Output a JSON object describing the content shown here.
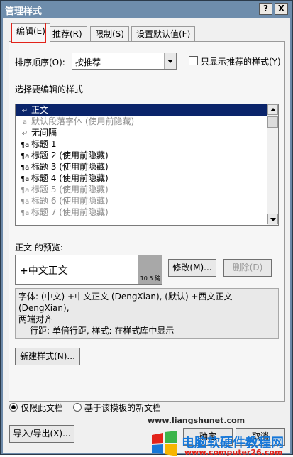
{
  "window": {
    "title": "管理样式",
    "help_btn": "?",
    "close_btn": "X"
  },
  "tabs": [
    {
      "label": "编辑(E)"
    },
    {
      "label": "推荐(R)"
    },
    {
      "label": "限制(S)"
    },
    {
      "label": "设置默认值(F)"
    }
  ],
  "sort": {
    "label": "排序顺序(O):",
    "value": "按推荐",
    "only_recommended_label": "只显示推荐的样式(Y)"
  },
  "select_label": "选择要编辑的样式",
  "styles": [
    {
      "icon": "↵",
      "name": "正文",
      "selected": true,
      "gray": false
    },
    {
      "icon": "a",
      "name": "默认段落字体  (使用前隐藏)",
      "selected": false,
      "gray": true
    },
    {
      "icon": "↵",
      "name": "无间隔",
      "selected": false,
      "gray": false
    },
    {
      "icon": "¶a",
      "name": "标题 1",
      "selected": false,
      "gray": false
    },
    {
      "icon": "¶a",
      "name": "标题 2  (使用前隐藏)",
      "selected": false,
      "gray": false
    },
    {
      "icon": "¶a",
      "name": "标题 3  (使用前隐藏)",
      "selected": false,
      "gray": false
    },
    {
      "icon": "¶a",
      "name": "标题 4  (使用前隐藏)",
      "selected": false,
      "gray": false
    },
    {
      "icon": "¶a",
      "name": "标题 5  (使用前隐藏)",
      "selected": false,
      "gray": true
    },
    {
      "icon": "¶a",
      "name": "标题 6  (使用前隐藏)",
      "selected": false,
      "gray": true
    },
    {
      "icon": "¶a",
      "name": "标题 7  (使用前隐藏)",
      "selected": false,
      "gray": true
    }
  ],
  "preview": {
    "label": "正文 的预览:",
    "text": "+中文正文",
    "size": "10.5 磅"
  },
  "buttons": {
    "modify": "修改(M)...",
    "delete": "删除(D)",
    "new_style": "新建样式(N)...",
    "import_export": "导入/导出(X)...",
    "ok": "确定",
    "cancel": "取消"
  },
  "description": {
    "line1": "字体: (中文) +中文正文 (DengXian), (默认) +西文正文 (DengXian),",
    "line2": "两端对齐",
    "line3": "行距: 单倍行距, 样式: 在样式库中显示"
  },
  "scope": {
    "this_document": "仅限此文档",
    "new_documents": "基于该模板的新文档"
  },
  "watermark": {
    "site1": "电脑软硬件教程网",
    "site2": "www.computer26.com",
    "url": "www.liangshunet.com",
    "colors": {
      "red": "#e2231a",
      "blue": "#1677d8"
    }
  }
}
